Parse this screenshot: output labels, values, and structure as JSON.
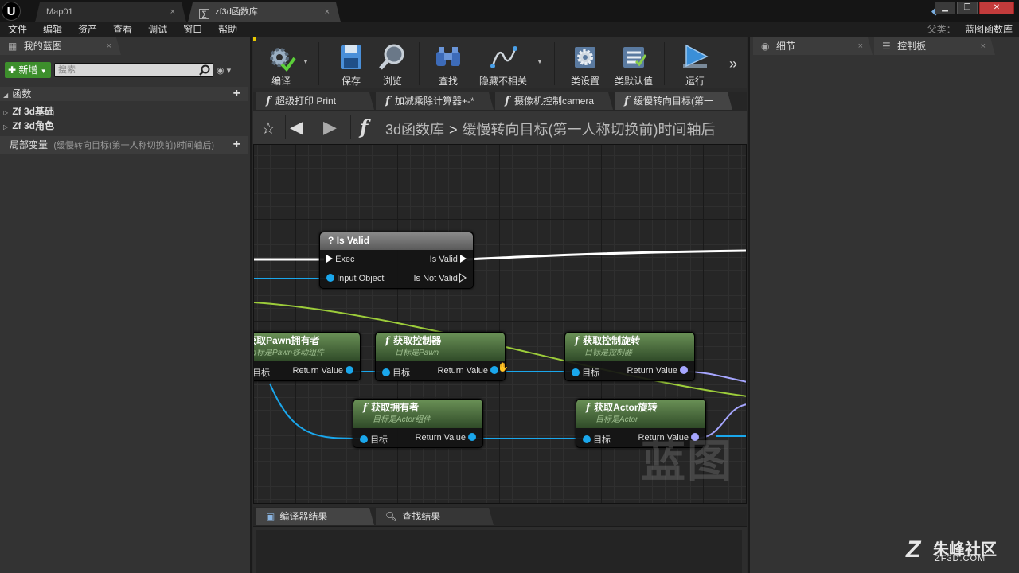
{
  "titlebar": {
    "tabs": [
      {
        "label": "Map01"
      },
      {
        "label": "zf3d函数库"
      }
    ],
    "close_glyph": "×"
  },
  "menu": {
    "items": [
      "文件",
      "编辑",
      "资产",
      "查看",
      "调试",
      "窗口",
      "帮助"
    ],
    "parent_label": "父类：",
    "parent_value": "蓝图函数库"
  },
  "left_panel": {
    "tab_label": "我的蓝图",
    "add_label": "新增",
    "search_placeholder": "搜索",
    "functions_label": "函数",
    "function_items": [
      "Zf 3d基础",
      "Zf 3d角色"
    ],
    "local_vars_label": "局部变量",
    "local_vars_sub": "(缓慢转向目标(第一人称切换前)时间轴后)"
  },
  "toolbar": {
    "buttons": [
      {
        "label": "编译",
        "icon": "compile-gear-icon"
      },
      {
        "label": "保存",
        "icon": "save-disk-icon"
      },
      {
        "label": "浏览",
        "icon": "browse-magnifier-icon"
      },
      {
        "label": "查找",
        "icon": "find-binoculars-icon"
      },
      {
        "label": "隐藏不相关",
        "icon": "hide-unrelated-icon"
      },
      {
        "label": "类设置",
        "icon": "class-settings-icon"
      },
      {
        "label": "类默认值",
        "icon": "class-defaults-icon"
      },
      {
        "label": "运行",
        "icon": "run-play-icon"
      }
    ]
  },
  "graph_tabs": [
    {
      "label": "超级打印 Print"
    },
    {
      "label": "加减乘除计算器+-*"
    },
    {
      "label": "摄像机控制camera"
    },
    {
      "label": "缓慢转向目标(第一"
    }
  ],
  "breadcrumb": {
    "library": "3d函数库",
    "function": "缓慢转向目标(第一人称切换前)时间轴后"
  },
  "nodes": {
    "is_valid": {
      "title": "Is Valid",
      "exec_in": "Exec",
      "input": "Input Object",
      "out_valid": "Is Valid",
      "out_not_valid": "Is Not Valid"
    },
    "get_pawn_owner": {
      "title": "获取Pawn拥有者",
      "subtitle": "目标是Pawn移动组件",
      "target": "目标",
      "return": "Return Value"
    },
    "get_controller": {
      "title": "获取控制器",
      "subtitle": "目标是Pawn",
      "target": "目标",
      "return": "Return Value"
    },
    "get_control_rotation": {
      "title": "获取控制旋转",
      "subtitle": "目标是控制器",
      "target": "目标",
      "return": "Return Value"
    },
    "get_owner": {
      "title": "获取拥有者",
      "subtitle": "目标是Actor组件",
      "target": "目标",
      "return": "Return Value"
    },
    "get_actor_rotation": {
      "title": "获取Actor旋转",
      "subtitle": "目标是Actor",
      "target": "目标",
      "return": "Return Value"
    }
  },
  "graph_watermark": "蓝图",
  "bottom_tabs": [
    {
      "label": "编译器结果"
    },
    {
      "label": "查找结果"
    }
  ],
  "right_panel": {
    "tabs": [
      {
        "label": "细节"
      },
      {
        "label": "控制板"
      }
    ]
  },
  "brand": {
    "name": "朱峰社区",
    "url": "ZF3D.COM"
  },
  "colors": {
    "exec_wire": "#ffffff",
    "object_wire": "#1aa7ec",
    "vector_wire": "#a6a6ff",
    "green_wire": "#9ccc3a",
    "add_button": "#3d8f2c",
    "function_header": "#4e7040"
  }
}
